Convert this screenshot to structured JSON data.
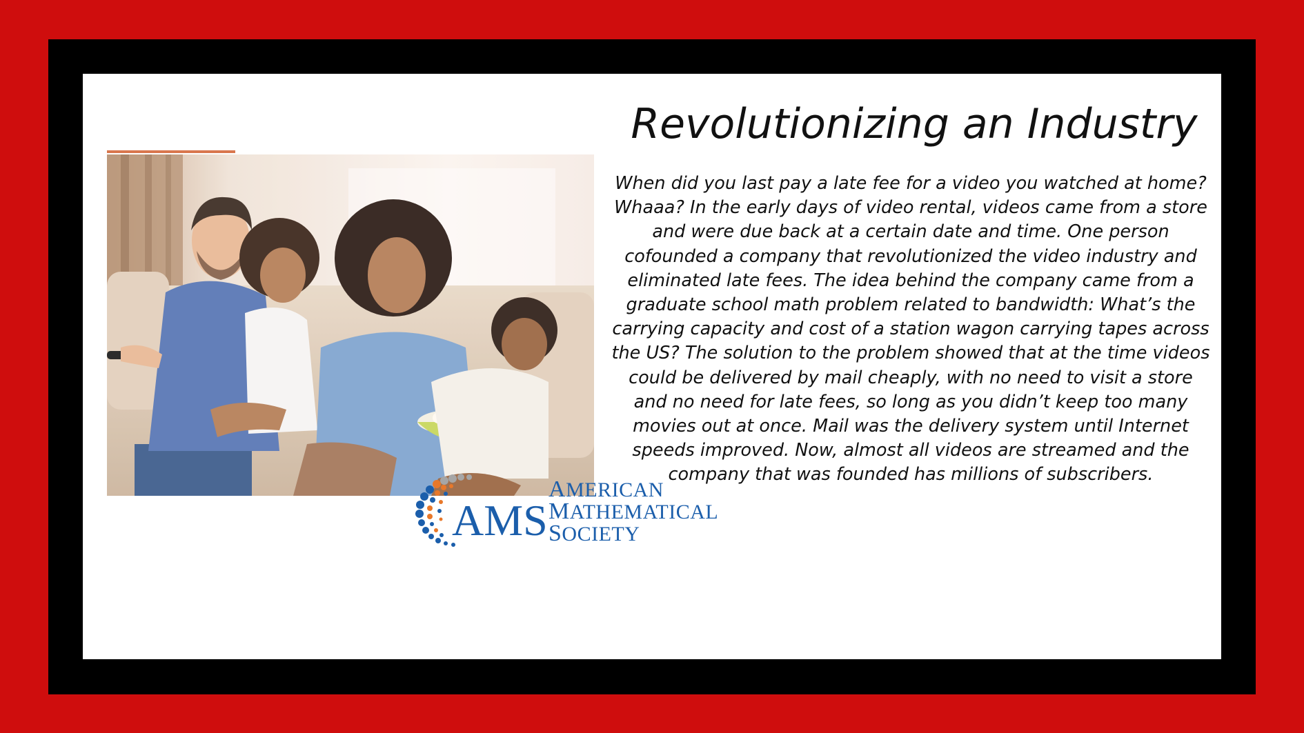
{
  "slide": {
    "title": "Revolutionizing an Industry",
    "body": "When did you last pay a late fee for a video you watched at home? Whaaa? In the early days of video rental, videos came from a store and were due back at a certain date and time. One person cofounded a company that revolutionized the video industry and eliminated late fees. The idea behind the company came from a graduate school math problem related to bandwidth: What’s the carrying capacity and cost of a station wagon carrying tapes across the US? The solution to the problem showed that at the time videos could be delivered by mail cheaply, with no need to visit a store and no need for late fees, so long as you didn’t keep too many movies out at once. Mail was the delivery system until Internet speeds improved. Now, almost all videos are streamed and the company that was founded has millions of subscribers."
  },
  "logo": {
    "acronym": "AMS",
    "line1_initial": "A",
    "line1_rest": "MERICAN",
    "line2_initial": "M",
    "line2_rest": "ATHEMATICAL",
    "line3_initial": "S",
    "line3_rest": "OCIETY"
  },
  "colors": {
    "outer_border": "#cf0d0d",
    "inner_border": "#000000",
    "accent": "#d9774e",
    "logo_blue": "#1b5eab",
    "logo_orange": "#e8782a",
    "logo_gray": "#a6a6a6"
  }
}
